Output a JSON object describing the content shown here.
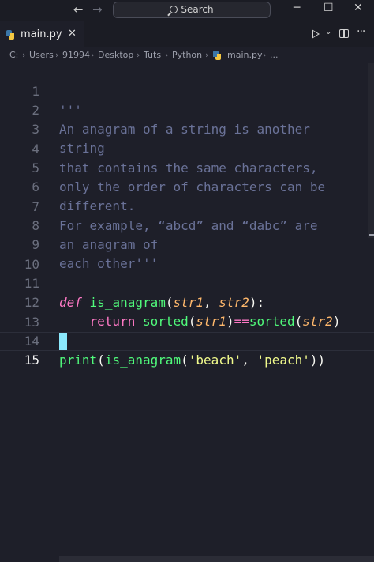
{
  "titlebar": {
    "back_arrow": "←",
    "forward_arrow": "→",
    "search_label": "Search",
    "minimize": "─",
    "maximize": "☐",
    "close": "✕"
  },
  "tab": {
    "filename": "main.py",
    "close": "✕",
    "more": "···"
  },
  "breadcrumb": [
    "C:",
    "Users",
    "91994",
    "Desktop",
    "Tuts",
    "Python",
    "main.py",
    "..."
  ],
  "editor": {
    "line_numbers": [
      "1",
      "2",
      "3",
      "4",
      "5",
      "6",
      "7",
      "8",
      "9",
      "10",
      "11",
      "12",
      "13",
      "14",
      "15"
    ],
    "docstring": [
      "'''",
      "An anagram of a string is another",
      "string",
      "that contains the same characters,",
      "only the order of characters can be",
      "different.",
      "For example, “abcd” and “dabc” are",
      "an anagram of",
      "each other'''"
    ],
    "line11": {
      "kw": "def",
      "fn": "is_anagram",
      "open": "(",
      "p1": "str1",
      "comma": ", ",
      "p2": "str2",
      "close": "):"
    },
    "line12": {
      "kw": "return",
      "fn1": "sorted",
      "open1": "(",
      "a1": "str1",
      "close1": ")",
      "op": "==",
      "fn2": "sorted",
      "open2": "(",
      "a2": "str2",
      "close2": ")"
    },
    "line14": {
      "fn1": "print",
      "open1": "(",
      "fn2": "is_anagram",
      "open2": "(",
      "s1": "'beach'",
      "comma": ", ",
      "s2": "'peach'",
      "close": "))"
    }
  },
  "colors": {
    "background": "#1e1f29",
    "keyword": "#ff79c6",
    "function": "#50fa7b",
    "parameter": "#ffb86c",
    "string": "#f1fa8c",
    "docstring": "#6a7298",
    "cursor": "#8be9fd"
  }
}
